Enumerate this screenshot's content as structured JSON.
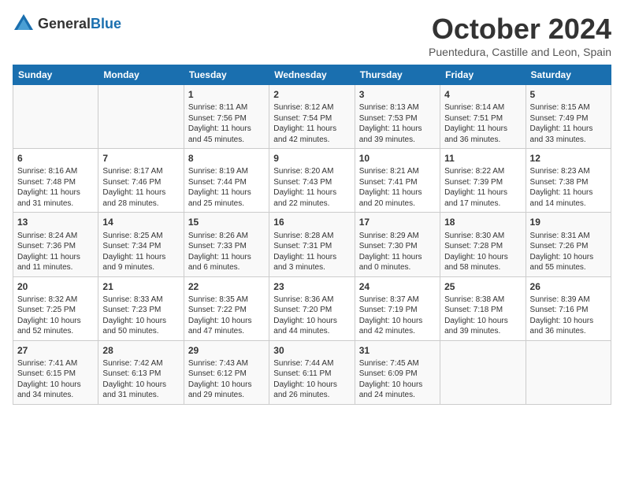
{
  "logo": {
    "general": "General",
    "blue": "Blue"
  },
  "title": "October 2024",
  "subtitle": "Puentedura, Castille and Leon, Spain",
  "weekdays": [
    "Sunday",
    "Monday",
    "Tuesday",
    "Wednesday",
    "Thursday",
    "Friday",
    "Saturday"
  ],
  "weeks": [
    [
      {
        "day": null
      },
      {
        "day": null
      },
      {
        "day": "1",
        "sunrise": "Sunrise: 8:11 AM",
        "sunset": "Sunset: 7:56 PM",
        "daylight": "Daylight: 11 hours and 45 minutes."
      },
      {
        "day": "2",
        "sunrise": "Sunrise: 8:12 AM",
        "sunset": "Sunset: 7:54 PM",
        "daylight": "Daylight: 11 hours and 42 minutes."
      },
      {
        "day": "3",
        "sunrise": "Sunrise: 8:13 AM",
        "sunset": "Sunset: 7:53 PM",
        "daylight": "Daylight: 11 hours and 39 minutes."
      },
      {
        "day": "4",
        "sunrise": "Sunrise: 8:14 AM",
        "sunset": "Sunset: 7:51 PM",
        "daylight": "Daylight: 11 hours and 36 minutes."
      },
      {
        "day": "5",
        "sunrise": "Sunrise: 8:15 AM",
        "sunset": "Sunset: 7:49 PM",
        "daylight": "Daylight: 11 hours and 33 minutes."
      }
    ],
    [
      {
        "day": "6",
        "sunrise": "Sunrise: 8:16 AM",
        "sunset": "Sunset: 7:48 PM",
        "daylight": "Daylight: 11 hours and 31 minutes."
      },
      {
        "day": "7",
        "sunrise": "Sunrise: 8:17 AM",
        "sunset": "Sunset: 7:46 PM",
        "daylight": "Daylight: 11 hours and 28 minutes."
      },
      {
        "day": "8",
        "sunrise": "Sunrise: 8:19 AM",
        "sunset": "Sunset: 7:44 PM",
        "daylight": "Daylight: 11 hours and 25 minutes."
      },
      {
        "day": "9",
        "sunrise": "Sunrise: 8:20 AM",
        "sunset": "Sunset: 7:43 PM",
        "daylight": "Daylight: 11 hours and 22 minutes."
      },
      {
        "day": "10",
        "sunrise": "Sunrise: 8:21 AM",
        "sunset": "Sunset: 7:41 PM",
        "daylight": "Daylight: 11 hours and 20 minutes."
      },
      {
        "day": "11",
        "sunrise": "Sunrise: 8:22 AM",
        "sunset": "Sunset: 7:39 PM",
        "daylight": "Daylight: 11 hours and 17 minutes."
      },
      {
        "day": "12",
        "sunrise": "Sunrise: 8:23 AM",
        "sunset": "Sunset: 7:38 PM",
        "daylight": "Daylight: 11 hours and 14 minutes."
      }
    ],
    [
      {
        "day": "13",
        "sunrise": "Sunrise: 8:24 AM",
        "sunset": "Sunset: 7:36 PM",
        "daylight": "Daylight: 11 hours and 11 minutes."
      },
      {
        "day": "14",
        "sunrise": "Sunrise: 8:25 AM",
        "sunset": "Sunset: 7:34 PM",
        "daylight": "Daylight: 11 hours and 9 minutes."
      },
      {
        "day": "15",
        "sunrise": "Sunrise: 8:26 AM",
        "sunset": "Sunset: 7:33 PM",
        "daylight": "Daylight: 11 hours and 6 minutes."
      },
      {
        "day": "16",
        "sunrise": "Sunrise: 8:28 AM",
        "sunset": "Sunset: 7:31 PM",
        "daylight": "Daylight: 11 hours and 3 minutes."
      },
      {
        "day": "17",
        "sunrise": "Sunrise: 8:29 AM",
        "sunset": "Sunset: 7:30 PM",
        "daylight": "Daylight: 11 hours and 0 minutes."
      },
      {
        "day": "18",
        "sunrise": "Sunrise: 8:30 AM",
        "sunset": "Sunset: 7:28 PM",
        "daylight": "Daylight: 10 hours and 58 minutes."
      },
      {
        "day": "19",
        "sunrise": "Sunrise: 8:31 AM",
        "sunset": "Sunset: 7:26 PM",
        "daylight": "Daylight: 10 hours and 55 minutes."
      }
    ],
    [
      {
        "day": "20",
        "sunrise": "Sunrise: 8:32 AM",
        "sunset": "Sunset: 7:25 PM",
        "daylight": "Daylight: 10 hours and 52 minutes."
      },
      {
        "day": "21",
        "sunrise": "Sunrise: 8:33 AM",
        "sunset": "Sunset: 7:23 PM",
        "daylight": "Daylight: 10 hours and 50 minutes."
      },
      {
        "day": "22",
        "sunrise": "Sunrise: 8:35 AM",
        "sunset": "Sunset: 7:22 PM",
        "daylight": "Daylight: 10 hours and 47 minutes."
      },
      {
        "day": "23",
        "sunrise": "Sunrise: 8:36 AM",
        "sunset": "Sunset: 7:20 PM",
        "daylight": "Daylight: 10 hours and 44 minutes."
      },
      {
        "day": "24",
        "sunrise": "Sunrise: 8:37 AM",
        "sunset": "Sunset: 7:19 PM",
        "daylight": "Daylight: 10 hours and 42 minutes."
      },
      {
        "day": "25",
        "sunrise": "Sunrise: 8:38 AM",
        "sunset": "Sunset: 7:18 PM",
        "daylight": "Daylight: 10 hours and 39 minutes."
      },
      {
        "day": "26",
        "sunrise": "Sunrise: 8:39 AM",
        "sunset": "Sunset: 7:16 PM",
        "daylight": "Daylight: 10 hours and 36 minutes."
      }
    ],
    [
      {
        "day": "27",
        "sunrise": "Sunrise: 7:41 AM",
        "sunset": "Sunset: 6:15 PM",
        "daylight": "Daylight: 10 hours and 34 minutes."
      },
      {
        "day": "28",
        "sunrise": "Sunrise: 7:42 AM",
        "sunset": "Sunset: 6:13 PM",
        "daylight": "Daylight: 10 hours and 31 minutes."
      },
      {
        "day": "29",
        "sunrise": "Sunrise: 7:43 AM",
        "sunset": "Sunset: 6:12 PM",
        "daylight": "Daylight: 10 hours and 29 minutes."
      },
      {
        "day": "30",
        "sunrise": "Sunrise: 7:44 AM",
        "sunset": "Sunset: 6:11 PM",
        "daylight": "Daylight: 10 hours and 26 minutes."
      },
      {
        "day": "31",
        "sunrise": "Sunrise: 7:45 AM",
        "sunset": "Sunset: 6:09 PM",
        "daylight": "Daylight: 10 hours and 24 minutes."
      },
      {
        "day": null
      },
      {
        "day": null
      }
    ]
  ]
}
